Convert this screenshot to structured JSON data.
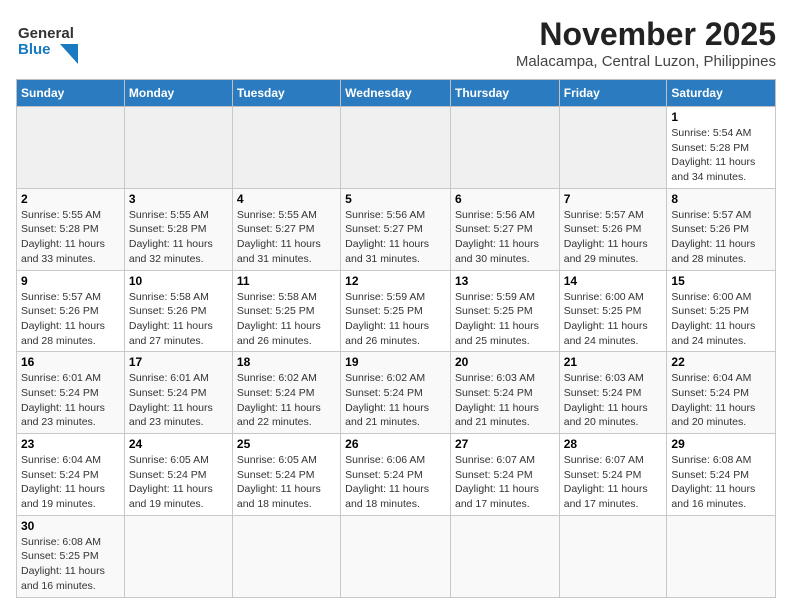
{
  "header": {
    "logo_line1": "General",
    "logo_line2": "Blue",
    "title": "November 2025",
    "subtitle": "Malacampa, Central Luzon, Philippines"
  },
  "weekdays": [
    "Sunday",
    "Monday",
    "Tuesday",
    "Wednesday",
    "Thursday",
    "Friday",
    "Saturday"
  ],
  "weeks": [
    {
      "days": [
        {
          "num": "",
          "info": ""
        },
        {
          "num": "",
          "info": ""
        },
        {
          "num": "",
          "info": ""
        },
        {
          "num": "",
          "info": ""
        },
        {
          "num": "",
          "info": ""
        },
        {
          "num": "",
          "info": ""
        },
        {
          "num": "1",
          "info": "Sunrise: 5:54 AM\nSunset: 5:28 PM\nDaylight: 11 hours\nand 34 minutes."
        }
      ]
    },
    {
      "days": [
        {
          "num": "2",
          "info": "Sunrise: 5:55 AM\nSunset: 5:28 PM\nDaylight: 11 hours\nand 33 minutes."
        },
        {
          "num": "3",
          "info": "Sunrise: 5:55 AM\nSunset: 5:28 PM\nDaylight: 11 hours\nand 32 minutes."
        },
        {
          "num": "4",
          "info": "Sunrise: 5:55 AM\nSunset: 5:27 PM\nDaylight: 11 hours\nand 31 minutes."
        },
        {
          "num": "5",
          "info": "Sunrise: 5:56 AM\nSunset: 5:27 PM\nDaylight: 11 hours\nand 31 minutes."
        },
        {
          "num": "6",
          "info": "Sunrise: 5:56 AM\nSunset: 5:27 PM\nDaylight: 11 hours\nand 30 minutes."
        },
        {
          "num": "7",
          "info": "Sunrise: 5:57 AM\nSunset: 5:26 PM\nDaylight: 11 hours\nand 29 minutes."
        },
        {
          "num": "8",
          "info": "Sunrise: 5:57 AM\nSunset: 5:26 PM\nDaylight: 11 hours\nand 28 minutes."
        }
      ]
    },
    {
      "days": [
        {
          "num": "9",
          "info": "Sunrise: 5:57 AM\nSunset: 5:26 PM\nDaylight: 11 hours\nand 28 minutes."
        },
        {
          "num": "10",
          "info": "Sunrise: 5:58 AM\nSunset: 5:26 PM\nDaylight: 11 hours\nand 27 minutes."
        },
        {
          "num": "11",
          "info": "Sunrise: 5:58 AM\nSunset: 5:25 PM\nDaylight: 11 hours\nand 26 minutes."
        },
        {
          "num": "12",
          "info": "Sunrise: 5:59 AM\nSunset: 5:25 PM\nDaylight: 11 hours\nand 26 minutes."
        },
        {
          "num": "13",
          "info": "Sunrise: 5:59 AM\nSunset: 5:25 PM\nDaylight: 11 hours\nand 25 minutes."
        },
        {
          "num": "14",
          "info": "Sunrise: 6:00 AM\nSunset: 5:25 PM\nDaylight: 11 hours\nand 24 minutes."
        },
        {
          "num": "15",
          "info": "Sunrise: 6:00 AM\nSunset: 5:25 PM\nDaylight: 11 hours\nand 24 minutes."
        }
      ]
    },
    {
      "days": [
        {
          "num": "16",
          "info": "Sunrise: 6:01 AM\nSunset: 5:24 PM\nDaylight: 11 hours\nand 23 minutes."
        },
        {
          "num": "17",
          "info": "Sunrise: 6:01 AM\nSunset: 5:24 PM\nDaylight: 11 hours\nand 23 minutes."
        },
        {
          "num": "18",
          "info": "Sunrise: 6:02 AM\nSunset: 5:24 PM\nDaylight: 11 hours\nand 22 minutes."
        },
        {
          "num": "19",
          "info": "Sunrise: 6:02 AM\nSunset: 5:24 PM\nDaylight: 11 hours\nand 21 minutes."
        },
        {
          "num": "20",
          "info": "Sunrise: 6:03 AM\nSunset: 5:24 PM\nDaylight: 11 hours\nand 21 minutes."
        },
        {
          "num": "21",
          "info": "Sunrise: 6:03 AM\nSunset: 5:24 PM\nDaylight: 11 hours\nand 20 minutes."
        },
        {
          "num": "22",
          "info": "Sunrise: 6:04 AM\nSunset: 5:24 PM\nDaylight: 11 hours\nand 20 minutes."
        }
      ]
    },
    {
      "days": [
        {
          "num": "23",
          "info": "Sunrise: 6:04 AM\nSunset: 5:24 PM\nDaylight: 11 hours\nand 19 minutes."
        },
        {
          "num": "24",
          "info": "Sunrise: 6:05 AM\nSunset: 5:24 PM\nDaylight: 11 hours\nand 19 minutes."
        },
        {
          "num": "25",
          "info": "Sunrise: 6:05 AM\nSunset: 5:24 PM\nDaylight: 11 hours\nand 18 minutes."
        },
        {
          "num": "26",
          "info": "Sunrise: 6:06 AM\nSunset: 5:24 PM\nDaylight: 11 hours\nand 18 minutes."
        },
        {
          "num": "27",
          "info": "Sunrise: 6:07 AM\nSunset: 5:24 PM\nDaylight: 11 hours\nand 17 minutes."
        },
        {
          "num": "28",
          "info": "Sunrise: 6:07 AM\nSunset: 5:24 PM\nDaylight: 11 hours\nand 17 minutes."
        },
        {
          "num": "29",
          "info": "Sunrise: 6:08 AM\nSunset: 5:24 PM\nDaylight: 11 hours\nand 16 minutes."
        }
      ]
    },
    {
      "days": [
        {
          "num": "30",
          "info": "Sunrise: 6:08 AM\nSunset: 5:25 PM\nDaylight: 11 hours\nand 16 minutes."
        },
        {
          "num": "",
          "info": ""
        },
        {
          "num": "",
          "info": ""
        },
        {
          "num": "",
          "info": ""
        },
        {
          "num": "",
          "info": ""
        },
        {
          "num": "",
          "info": ""
        },
        {
          "num": "",
          "info": ""
        }
      ]
    }
  ]
}
